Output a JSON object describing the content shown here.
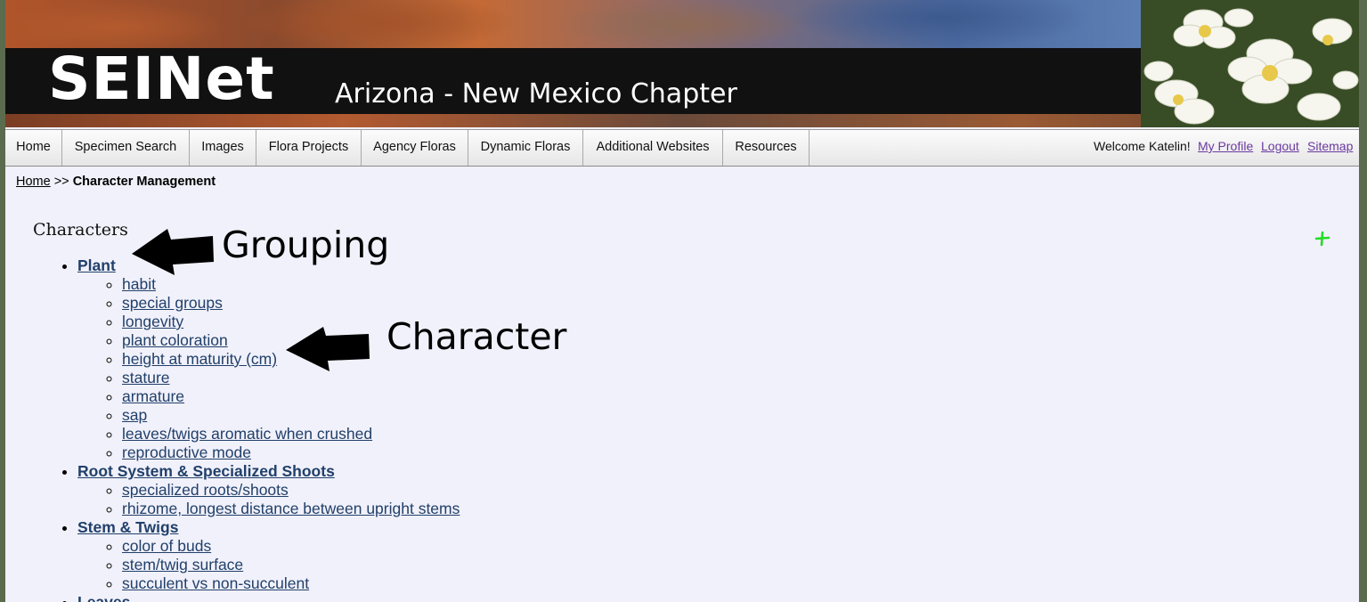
{
  "banner": {
    "logo": "SEINet",
    "chapter": "Arizona - New Mexico Chapter"
  },
  "nav": {
    "items": [
      "Home",
      "Specimen Search",
      "Images",
      "Flora Projects",
      "Agency Floras",
      "Dynamic Floras",
      "Additional Websites",
      "Resources"
    ],
    "welcome": "Welcome Katelin!",
    "my_profile": "My Profile",
    "logout": "Logout",
    "sitemap": "Sitemap"
  },
  "breadcrumb": {
    "home": "Home",
    "separator": ">>",
    "current": "Character Management"
  },
  "page": {
    "heading": "Characters",
    "add_icon": "plus-icon",
    "add_icon_color": "#22dd22"
  },
  "groups": [
    {
      "name": "Plant",
      "characters": [
        "habit",
        "special groups",
        "longevity",
        "plant coloration",
        "height at maturity (cm)",
        "stature",
        "armature",
        "sap",
        "leaves/twigs aromatic when crushed",
        "reproductive mode"
      ]
    },
    {
      "name": "Root System & Specialized Shoots",
      "characters": [
        "specialized roots/shoots",
        "rhizome, longest distance between upright stems"
      ]
    },
    {
      "name": "Stem & Twigs",
      "characters": [
        "color of buds",
        "stem/twig surface",
        "succulent vs non-succulent"
      ]
    },
    {
      "name": "Leaves",
      "characters": []
    }
  ],
  "annotations": {
    "grouping": "Grouping",
    "character": "Character"
  }
}
